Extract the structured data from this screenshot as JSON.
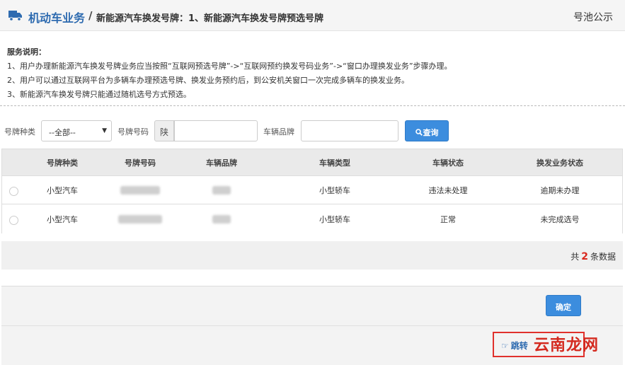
{
  "header": {
    "title": "机动车业务",
    "separator": "/",
    "subtitle": "新能源汽车换发号牌：1、新能源汽车换发号牌预选号牌",
    "right_link": "号池公示"
  },
  "notes": {
    "title": "服务说明：",
    "lines": [
      "1、用户办理新能源汽车换发号牌业务应当按照“互联网预选号牌”->“互联网预约换发号码业务”->“窗口办理换发业务”步骤办理。",
      "2、用户可以通过互联网平台为多辆车办理预选号牌、换发业务预约后，到公安机关窗口一次完成多辆车的换发业务。",
      "3、新能源汽车换发号牌只能通过随机选号方式预选。"
    ]
  },
  "filters": {
    "plate_type_label": "号牌种类",
    "plate_type_value": "--全部--",
    "plate_number_label": "号牌号码",
    "plate_prefix": "陕",
    "plate_number_value": "",
    "brand_label": "车辆品牌",
    "brand_value": "",
    "search_label": "查询"
  },
  "table": {
    "headers": [
      "号牌种类",
      "号牌号码",
      "车辆品牌",
      "车辆类型",
      "车辆状态",
      "换发业务状态"
    ],
    "rows": [
      {
        "plate_type": "小型汽车",
        "vehicle_type": "小型轿车",
        "vehicle_status": "违法未处理",
        "business_status": "逾期未办理"
      },
      {
        "plate_type": "小型汽车",
        "vehicle_type": "小型轿车",
        "vehicle_status": "正常",
        "business_status": "未完成选号"
      }
    ]
  },
  "pager": {
    "prefix": "共",
    "count": "2",
    "suffix": "条数据"
  },
  "footer": {
    "confirm_label": "确定",
    "jump_label": "跳转"
  },
  "watermark": "云南龙网",
  "colors": {
    "accent": "#3c8dde",
    "title_blue": "#2e6bb0",
    "highlight_red": "#e0312c"
  }
}
